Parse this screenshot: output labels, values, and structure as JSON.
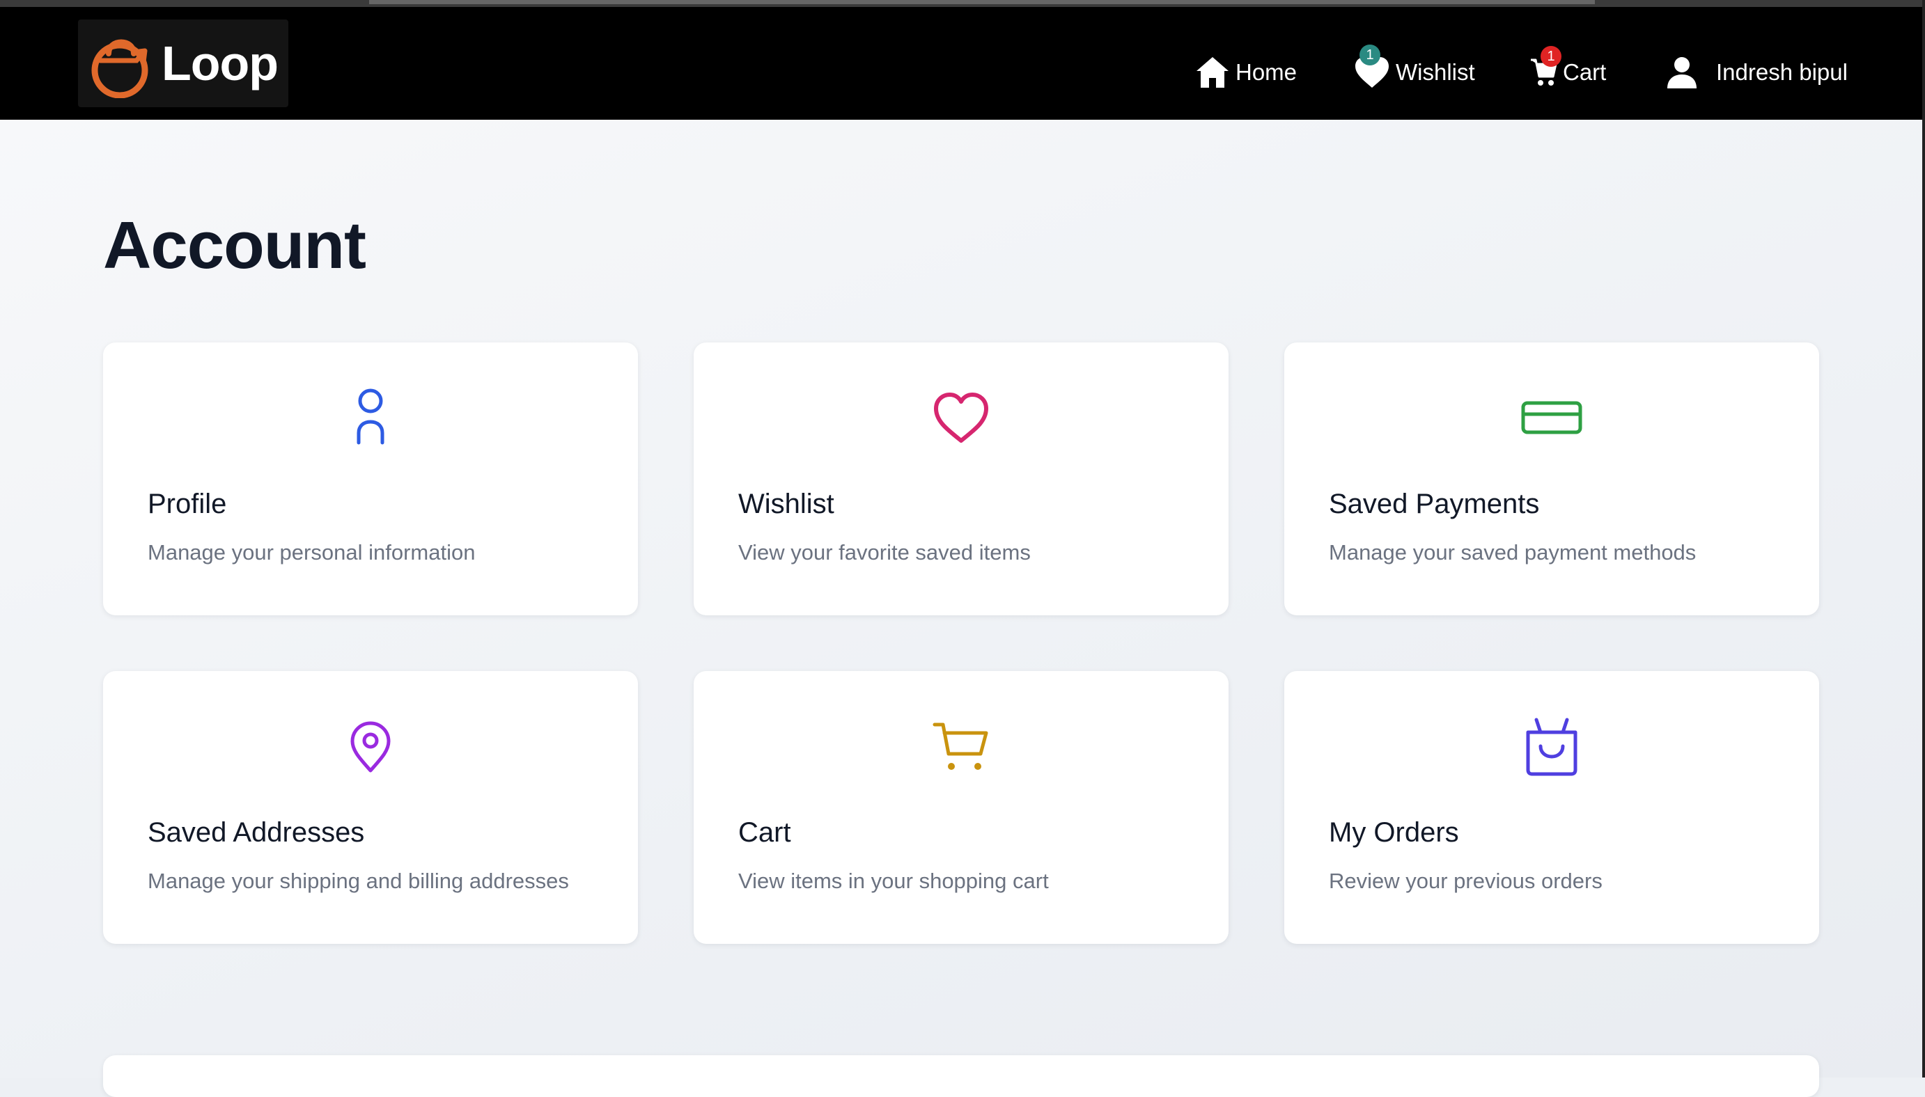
{
  "header": {
    "logo_text": "Loop",
    "nav": {
      "home": "Home",
      "wishlist": "Wishlist",
      "wishlist_count": "1",
      "cart": "Cart",
      "cart_count": "1",
      "user": "Indresh bipul"
    }
  },
  "page": {
    "title": "Account"
  },
  "cards": [
    {
      "title": "Profile",
      "description": "Manage your personal information",
      "icon": "user-icon",
      "color": "#2d5be3"
    },
    {
      "title": "Wishlist",
      "description": "View your favorite saved items",
      "icon": "heart-icon",
      "color": "#d6266f"
    },
    {
      "title": "Saved Payments",
      "description": "Manage your saved payment methods",
      "icon": "credit-card-icon",
      "color": "#2ea043"
    },
    {
      "title": "Saved Addresses",
      "description": "Manage your shipping and billing addresses",
      "icon": "map-pin-icon",
      "color": "#9a2ae0"
    },
    {
      "title": "Cart",
      "description": "View items in your shopping cart",
      "icon": "shopping-cart-icon",
      "color": "#c9930e"
    },
    {
      "title": "My Orders",
      "description": "Review your previous orders",
      "icon": "shopping-bag-icon",
      "color": "#4f3fe0"
    }
  ],
  "colors": {
    "navbar": "#000000",
    "brand_orange": "#e0692b",
    "wishlist_badge": "#2a8a82",
    "cart_badge": "#e02424",
    "title": "#111827",
    "muted": "#6b7280"
  }
}
